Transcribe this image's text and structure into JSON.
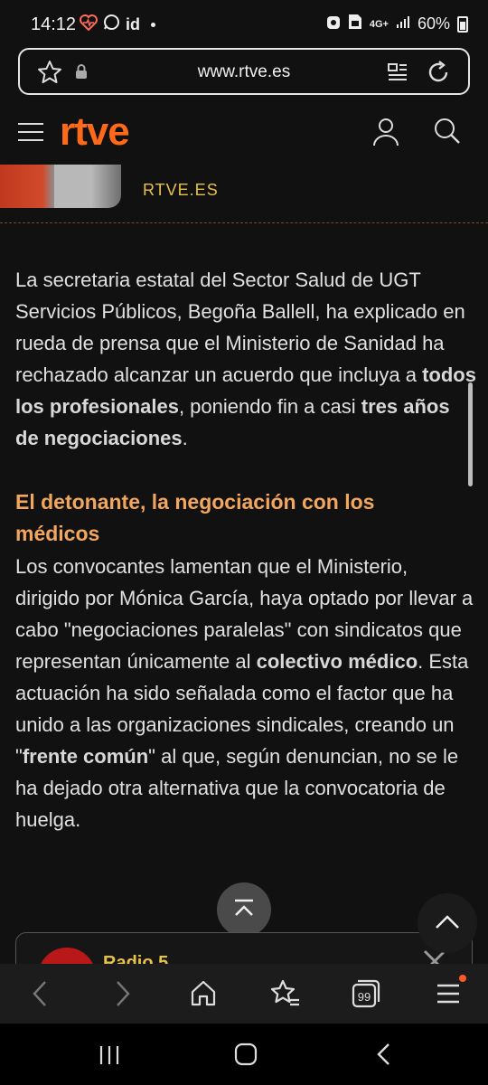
{
  "status_bar": {
    "time": "14:12",
    "app_id": "id",
    "network": "4G+",
    "battery": "60%"
  },
  "browser": {
    "url": "www.rtve.es"
  },
  "site": {
    "logo": "rtve",
    "source_label": "RTVE.ES"
  },
  "article": {
    "p1": [
      {
        "t": "La secretaria estatal del Sector Salud de UGT Servicios Públicos, Begoña Ballell, ha explicado en rueda de prensa que el Ministerio de Sanidad ha rechazado alcanzar un acuerdo que incluya a "
      },
      {
        "t": "todos los profesionales",
        "b": true
      },
      {
        "t": ", poniendo fin a casi "
      },
      {
        "t": "tres años de negociaciones",
        "b": true
      },
      {
        "t": "."
      }
    ],
    "heading": "El detonante, la negociación con los médicos",
    "p2": [
      {
        "t": "Los convocantes lamentan que el Ministerio, dirigido por Mónica García, haya optado por llevar a cabo \"negociaciones paralelas\" con sindicatos que representan únicamente al "
      },
      {
        "t": "colectivo médico",
        "b": true
      },
      {
        "t": ". Esta actuación ha sido señalada como el factor que ha unido a las organizaciones sindicales, creando un \""
      },
      {
        "t": "frente común",
        "b": true
      },
      {
        "t": "\" al que, según denuncian, no se le ha dejado otra alternativa que la convocatoria de huelga."
      }
    ]
  },
  "player_card": {
    "title": "Radio 5"
  },
  "bottom_bar": {
    "tabs_count": "99",
    "items": [
      "back-icon",
      "forward-icon",
      "home-icon",
      "bookmarks-icon",
      "tabs-icon",
      "menu-icon"
    ]
  },
  "colors": {
    "accent": "#ff6a1a",
    "heading": "#f2a65e",
    "source": "#e6c24a"
  }
}
